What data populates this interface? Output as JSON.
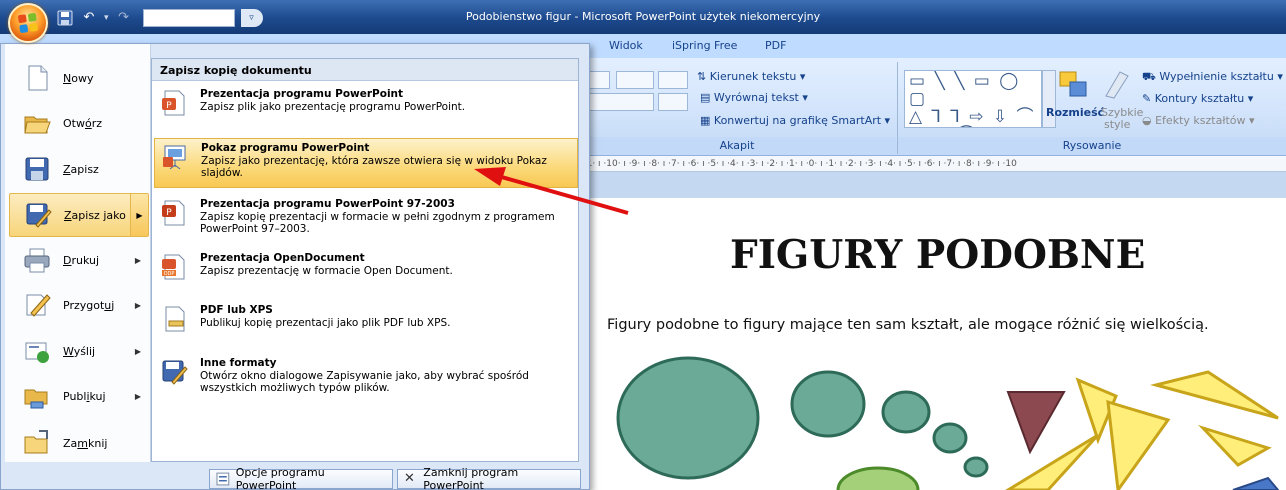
{
  "window": {
    "title": "Podobienstwo figur - Microsoft PowerPoint użytek niekomercyjny",
    "title_bar_color": "#1d4a8d"
  },
  "quick_access": {
    "icons": [
      "save-icon",
      "undo-icon",
      "redo-icon",
      "customize-dropdown-icon"
    ],
    "more": "▿"
  },
  "ribbon": {
    "tabs": [
      "Widok",
      "iSpring Free",
      "PDF"
    ],
    "akapit": {
      "label": "Akapit",
      "kierunek_tekstu": "Kierunek tekstu",
      "wyrownaj_tekst": "Wyrównaj tekst",
      "konwertuj": "Konwertuj na grafikę SmartArt"
    },
    "rysowanie": {
      "label": "Rysowanie",
      "rozmiesc": "Rozmieść",
      "szybkie_style": [
        "Szybkie",
        "style"
      ],
      "wypelnienie": "Wypełnienie kształtu",
      "kontury": "Kontury kształtu",
      "efekty": "Efekty kształtów",
      "shapes_rows": [
        "▭ ╲ ╲ ▭ ◯ ▢",
        "△ ⅂ ⅂ ⇨ ⇩ ⌒",
        "☈ ◠ ⌒ { } ☆"
      ]
    }
  },
  "ruler": {
    "text": "·11· ı ·10· ı ·9· ı ·8· ı ·7· ı ·6· ı ·5· ı ·4· ı ·3· ı ·2· ı ·1· ı ·0· ı ·1· ı ·2· ı ·3· ı ·4· ı ·5· ı ·6· ı ·7· ı ·8· ı ·9· ı ·10"
  },
  "slide": {
    "title": "FIGURY PODOBNE",
    "text": "Figury podobne to figury mające ten sam kształt, ale mogące różnić się wielkością.",
    "circle_color": "#6aaa96",
    "triangle_color": "#ffef7a",
    "dark_triangle_color": "#8c4a50"
  },
  "office_menu": {
    "items": [
      {
        "label": "Nowy",
        "key": "N",
        "rest": "owy",
        "icon": "new-document-icon",
        "arrow": false
      },
      {
        "label": "Otwórz",
        "key": "",
        "pre": "Otw",
        "keychar": "ó",
        "rest": "rz",
        "icon": "open-folder-icon",
        "arrow": false
      },
      {
        "label": "Zapisz",
        "key": "Z",
        "rest": "apisz",
        "icon": "save-icon",
        "arrow": false
      },
      {
        "label": "Zapisz jako",
        "key": "Z",
        "rest": "apisz jako",
        "icon": "save-as-icon",
        "arrow": true
      },
      {
        "label": "Drukuj",
        "key": "D",
        "rest": "rukuj",
        "icon": "print-icon",
        "arrow": true
      },
      {
        "label": "Przygotuj",
        "pre": "Przygot",
        "keychar": "u",
        "rest": "j",
        "icon": "prepare-icon",
        "arrow": true
      },
      {
        "label": "Wyślij",
        "key": "W",
        "rest": "yślij",
        "icon": "send-icon",
        "arrow": true
      },
      {
        "label": "Publikuj",
        "pre": "Publ",
        "keychar": "i",
        "rest": "kuj",
        "icon": "publish-icon",
        "arrow": true
      },
      {
        "label": "Zamknij",
        "pre": "Za",
        "keychar": "m",
        "rest": "knij",
        "icon": "close-icon",
        "arrow": false
      }
    ],
    "submenu_title": "Zapisz kopię dokumentu",
    "submenu": [
      {
        "title": "Prezentacja programu PowerPoint",
        "desc": "Zapisz plik jako prezentację programu PowerPoint."
      },
      {
        "title": "Pokaz programu PowerPoint",
        "desc": "Zapisz jako prezentację, która zawsze otwiera się w widoku  Pokaz slajdów."
      },
      {
        "title": "Prezentacja programu PowerPoint 97-2003",
        "desc": "Zapisz kopię prezentacji w formacie w pełni zgodnym z programem PowerPoint 97–2003."
      },
      {
        "title": "Prezentacja OpenDocument",
        "desc": "Zapisz prezentację w formacie Open Document."
      },
      {
        "title": "PDF lub XPS",
        "desc": "Publikuj kopię prezentacji jako plik PDF lub XPS."
      },
      {
        "title": "Inne formaty",
        "desc": "Otwórz okno dialogowe Zapisywanie jako, aby wybrać spośród wszystkich możliwych typów plików."
      }
    ],
    "options_button": "Opcje programu PowerPoint",
    "exit_button": "Zamknij program PowerPoint",
    "highlight_color": "#f8c853"
  },
  "annotation": {
    "arrow_color": "#e01010"
  }
}
